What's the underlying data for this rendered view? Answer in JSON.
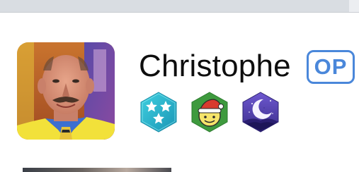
{
  "profile": {
    "username": "Christophe",
    "op_label": "OP",
    "avatar_icon": "user-avatar-photo",
    "badges": [
      {
        "name": "stars-badge",
        "icon": "stars-icon",
        "color": "#2ab3c7"
      },
      {
        "name": "santa-smiley-badge",
        "icon": "santa-hat-smiley-icon",
        "color": "#3d9a3f"
      },
      {
        "name": "moon-night-badge",
        "icon": "crescent-moon-icon",
        "color": "#5a47b8"
      }
    ]
  },
  "colors": {
    "op_accent": "#4a87da",
    "topbar": "#d9dde2"
  }
}
